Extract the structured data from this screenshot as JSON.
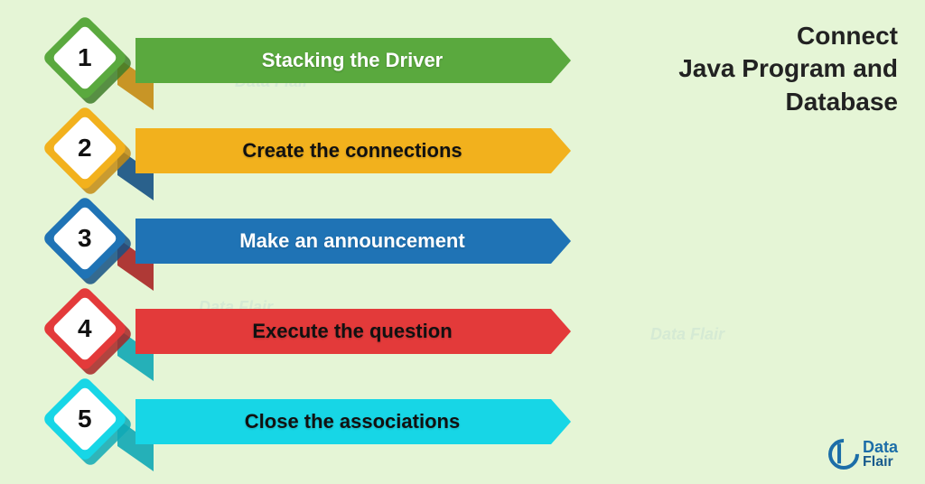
{
  "title": {
    "l1": "Connect",
    "l2": "Java Program and",
    "l3": "Database"
  },
  "brand": {
    "name1": "Data",
    "name2": "Flair"
  },
  "steps": [
    {
      "num": "1",
      "label": "Stacking the Driver",
      "fill": "#5aa93e",
      "dark": "#3e7c29",
      "text": "#fff"
    },
    {
      "num": "2",
      "label": "Create the connections",
      "fill": "#f2b11d",
      "dark": "#c48b13",
      "text": "#111"
    },
    {
      "num": "3",
      "label": "Make an announcement",
      "fill": "#1f73b5",
      "dark": "#155184",
      "text": "#fff"
    },
    {
      "num": "4",
      "label": "Execute the question",
      "fill": "#e33a3a",
      "dark": "#a82525",
      "text": "#111"
    },
    {
      "num": "5",
      "label": "Close the associations",
      "fill": "#17d6e6",
      "dark": "#0fa9b5",
      "text": "#111"
    }
  ]
}
